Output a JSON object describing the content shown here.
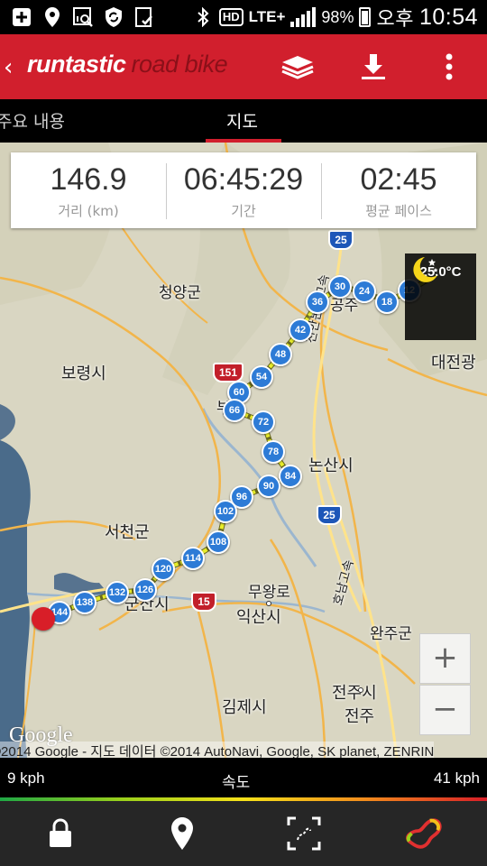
{
  "status_bar": {
    "battery": "98%",
    "network": "LTE+",
    "hd": "HD",
    "ampm": "오후",
    "time": "10:54"
  },
  "app_bar": {
    "brand_main": "runtastic",
    "brand_sub": "road bike",
    "icons": [
      "back-chevron-icon",
      "layers-icon",
      "download-icon",
      "overflow-menu-icon"
    ],
    "accent_color": "#d11f2d"
  },
  "tabs": [
    {
      "label": "주요 내용",
      "active": false
    },
    {
      "label": "지도",
      "active": true
    }
  ],
  "stats": {
    "distance_value": "146.9",
    "distance_label": "거리 (km)",
    "duration_value": "06:45:29",
    "duration_label": "기간",
    "pace_value": "02:45",
    "pace_label": "평균 페이스"
  },
  "weather": {
    "icon": "moon-stars-icon",
    "temperature": "25.0°C"
  },
  "map": {
    "places": {
      "cheongyang": "청양군",
      "boryeong": "보령시",
      "daejeon": "대전광",
      "nonsan": "논산시",
      "seocheon": "서천군",
      "gunsan": "군산시",
      "muwangro": "무왕로",
      "iksan": "익산시",
      "wanju": "완주군",
      "gimje": "김제시",
      "jeonju_city": "전주시",
      "jeonju": "전주",
      "buyeo": "부여",
      "gongju": "공주",
      "cheonan_nonsan_exp": "천안논산고속",
      "honam_exp": "호남고속"
    },
    "highways": [
      "25",
      "151",
      "25",
      "15"
    ],
    "km_markers": [
      "12",
      "18",
      "24",
      "30",
      "36",
      "42",
      "48",
      "54",
      "60",
      "66",
      "72",
      "78",
      "84",
      "90",
      "96",
      "102",
      "108",
      "114",
      "120",
      "126",
      "132",
      "138",
      "144"
    ],
    "route_color": "#e9ee2a",
    "marker_color": "#2d7bd6",
    "start_color": "#d81e28",
    "zoom_in": "+",
    "zoom_out": "−",
    "google_logo": "Google",
    "copyright": "©2014 Google - 지도 데이터 ©2014 AutoNavi, Google, SK planet, ZENRIN"
  },
  "speed_legend": {
    "min": "9 kph",
    "label": "속도",
    "max": "41 kph"
  },
  "bottom_toolbar": {
    "icons": [
      "lock-icon",
      "map-pin-icon",
      "fit-route-icon",
      "route-shape-icon"
    ]
  }
}
